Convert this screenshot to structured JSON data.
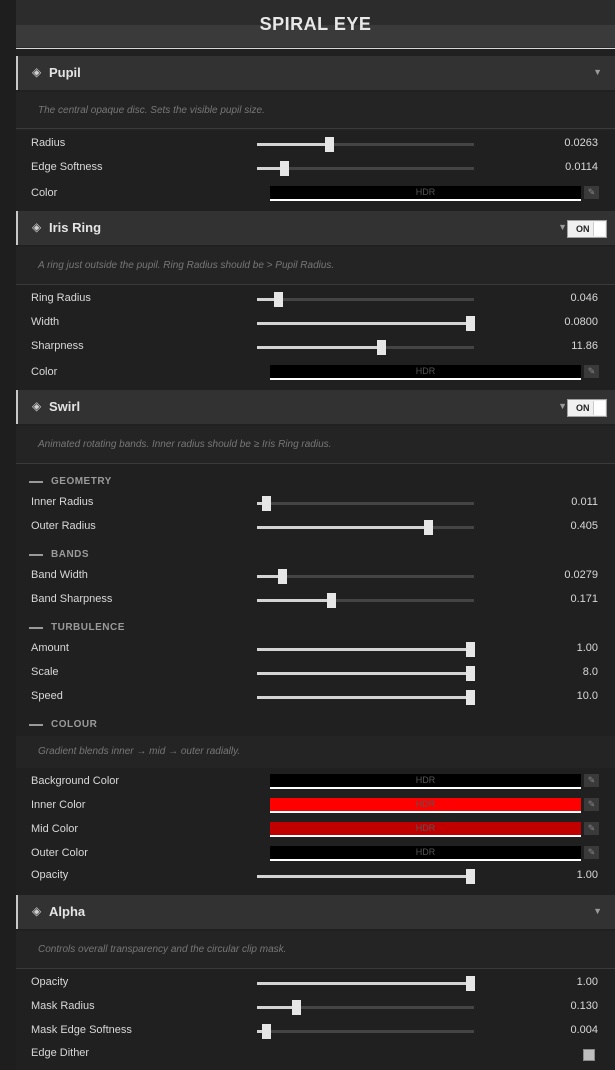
{
  "title": "SPIRAL EYE",
  "icons": {
    "section": "diamond-icon",
    "collapse": "caret-down-icon",
    "picker": "eyedropper-icon"
  },
  "colors": {
    "accent": "#d4d4d4",
    "black": "#000000",
    "red": "#ff0000",
    "dark_red": "#c00000"
  },
  "hdr_label": "HDR",
  "picker_glyph": "✎",
  "diamond_glyph": "◈",
  "arrow_glyph": "▼",
  "pupil": {
    "title": "Pupil",
    "desc": "The central opaque disc. Sets the visible pupil size.",
    "radius": {
      "label": "Radius",
      "value": "0.0263",
      "fill": 0.33
    },
    "edge_softness": {
      "label": "Edge Softness",
      "value": "0.0114",
      "fill": 0.125
    },
    "color": {
      "label": "Color"
    }
  },
  "iris": {
    "title": "Iris Ring",
    "toggle": "ON",
    "desc": "A ring just outside the pupil. Ring Radius should be > Pupil Radius.",
    "ring_radius": {
      "label": "Ring Radius",
      "value": "0.046",
      "fill": 0.095
    },
    "width": {
      "label": "Width",
      "value": "0.0800",
      "fill": 0.98
    },
    "sharpness": {
      "label": "Sharpness",
      "value": "11.86",
      "fill": 0.57
    },
    "color": {
      "label": "Color"
    }
  },
  "swirl": {
    "title": "Swirl",
    "toggle": "ON",
    "desc": "Animated rotating bands. Inner radius should be ≥ Iris Ring radius.",
    "geometry": "GEOMETRY",
    "inner_radius": {
      "label": "Inner Radius",
      "value": "0.011",
      "fill": 0.04
    },
    "outer_radius": {
      "label": "Outer Radius",
      "value": "0.405",
      "fill": 0.79
    },
    "bands": "BANDS",
    "band_width": {
      "label": "Band Width",
      "value": "0.0279",
      "fill": 0.115
    },
    "band_sharpness": {
      "label": "Band Sharpness",
      "value": "0.171",
      "fill": 0.34
    },
    "turbulence": "TURBULENCE",
    "amount": {
      "label": "Amount",
      "value": "1.00",
      "fill": 0.98
    },
    "scale": {
      "label": "Scale",
      "value": "8.0",
      "fill": 0.98
    },
    "speed": {
      "label": "Speed",
      "value": "10.0",
      "fill": 0.98
    },
    "colour": "COLOUR",
    "colour_desc": "Gradient blends inner → mid → outer radially.",
    "background_color": {
      "label": "Background Color"
    },
    "inner_color": {
      "label": "Inner Color"
    },
    "mid_color": {
      "label": "Mid Color"
    },
    "outer_color": {
      "label": "Outer Color"
    },
    "opacity": {
      "label": "Opacity",
      "value": "1.00",
      "fill": 0.98
    }
  },
  "alpha": {
    "title": "Alpha",
    "desc": "Controls overall transparency and the circular clip mask.",
    "opacity": {
      "label": "Opacity",
      "value": "1.00",
      "fill": 0.98
    },
    "mask_radius": {
      "label": "Mask Radius",
      "value": "0.130",
      "fill": 0.18
    },
    "mask_edge_softness": {
      "label": "Mask Edge Softness",
      "value": "0.004",
      "fill": 0.04
    },
    "edge_dither": {
      "label": "Edge Dither",
      "checked": false
    }
  }
}
